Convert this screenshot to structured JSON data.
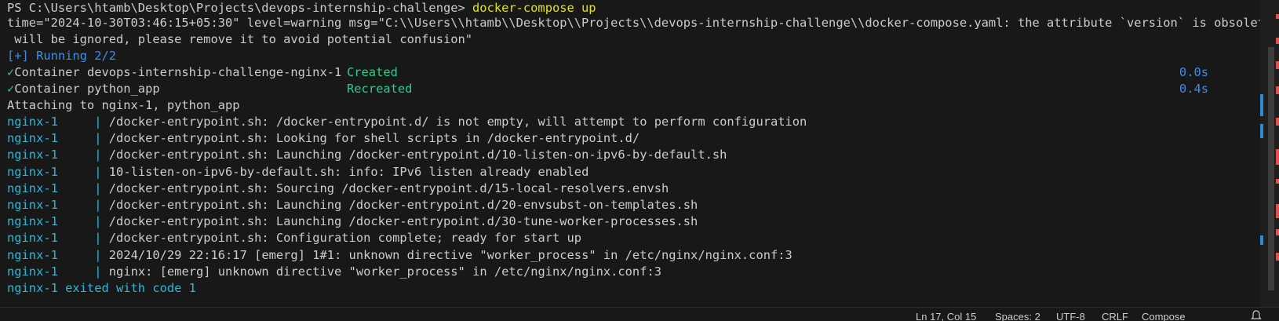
{
  "prompt": {
    "prefix": "PS C:\\Users\\htamb\\Desktop\\Projects\\devops-internship-challenge> ",
    "command": "docker-compose up"
  },
  "warning_line_1": "time=\"2024-10-30T03:46:15+05:30\" level=warning msg=\"C:\\\\Users\\\\htamb\\\\Desktop\\\\Projects\\\\devops-internship-challenge\\\\docker-compose.yaml: the attribute `version` is obsolete, it",
  "warning_line_2": " will be ignored, please remove it to avoid potential confusion\"",
  "running": "[+] Running 2/2",
  "containers": [
    {
      "check": "✓",
      "name": "Container devops-internship-challenge-nginx-1",
      "status": "Created",
      "time": "0.0s"
    },
    {
      "check": "✓",
      "name": "Container python_app",
      "status": "Recreated",
      "time": "0.4s"
    }
  ],
  "attaching": "Attaching to nginx-1, python_app",
  "log_prefix": "nginx-1",
  "log_pipe": "|",
  "logs": [
    "/docker-entrypoint.sh: /docker-entrypoint.d/ is not empty, will attempt to perform configuration",
    "/docker-entrypoint.sh: Looking for shell scripts in /docker-entrypoint.d/",
    "/docker-entrypoint.sh: Launching /docker-entrypoint.d/10-listen-on-ipv6-by-default.sh",
    "10-listen-on-ipv6-by-default.sh: info: IPv6 listen already enabled",
    "/docker-entrypoint.sh: Sourcing /docker-entrypoint.d/15-local-resolvers.envsh",
    "/docker-entrypoint.sh: Launching /docker-entrypoint.d/20-envsubst-on-templates.sh",
    "/docker-entrypoint.sh: Launching /docker-entrypoint.d/30-tune-worker-processes.sh",
    "/docker-entrypoint.sh: Configuration complete; ready for start up",
    "2024/10/29 22:16:17 [emerg] 1#1: unknown directive \"worker_process\" in /etc/nginx/nginx.conf:3",
    "nginx: [emerg] unknown directive \"worker_process\" in /etc/nginx/nginx.conf:3"
  ],
  "exit_line": "nginx-1 exited with code 1",
  "statusbar": {
    "position": "Ln 17, Col 15",
    "spaces": "Spaces: 2",
    "encoding": "UTF-8",
    "eol": "CRLF",
    "language": "Compose"
  },
  "colors": {
    "background": "#181818",
    "text": "#cccccc",
    "command": "#e5e510",
    "running": "#3b8eea",
    "status_green": "#23d18b",
    "log_prefix": "#29b8db",
    "ruler_red": "#e05252",
    "ruler_blue": "#2f8ad1"
  }
}
